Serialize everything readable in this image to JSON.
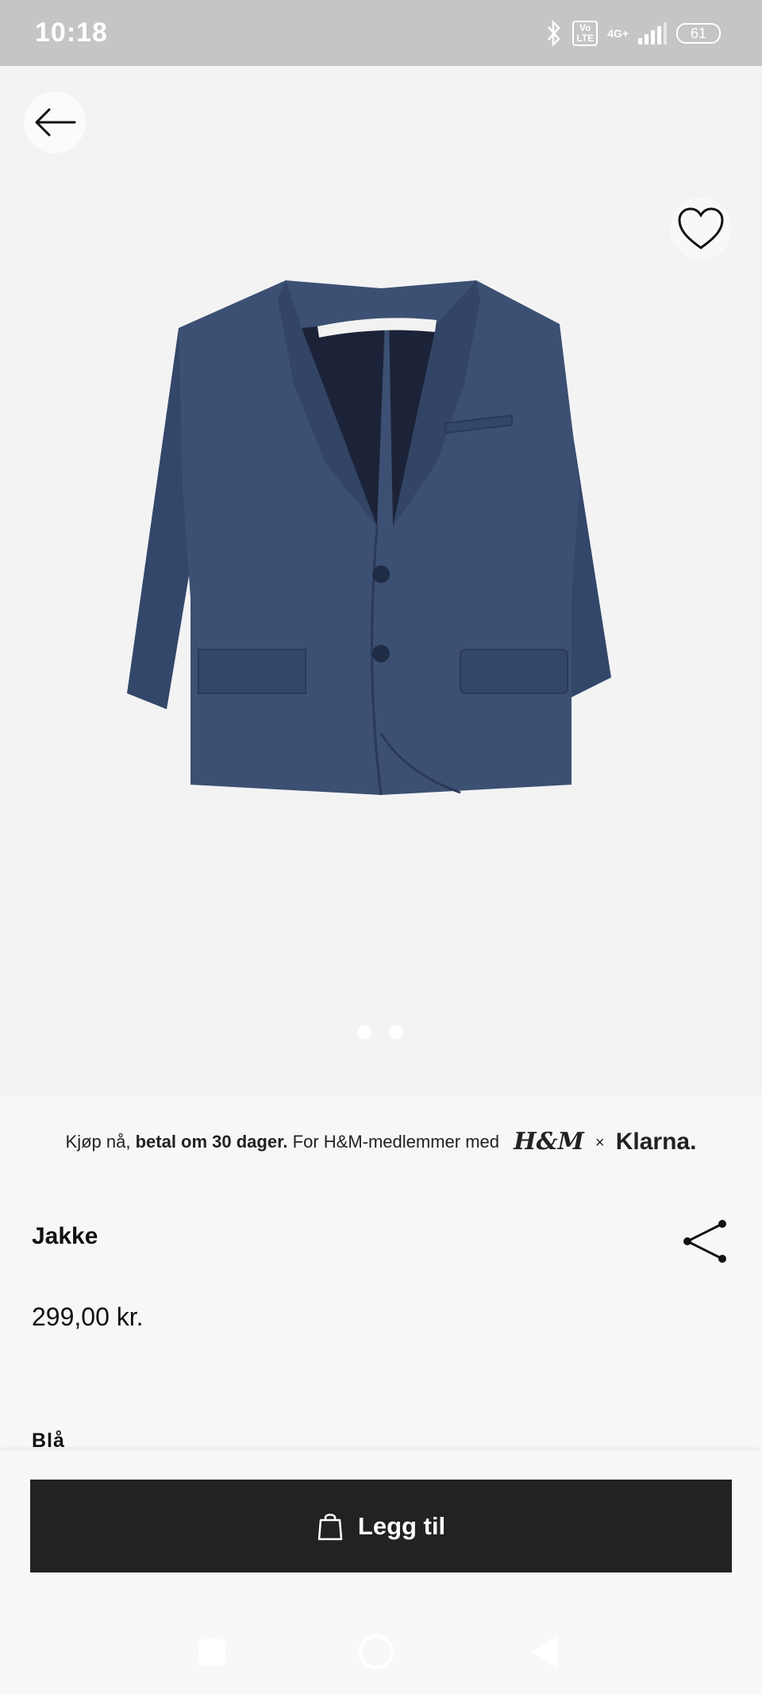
{
  "status": {
    "time": "10:18",
    "network": "4G+",
    "volte": "Vo\nLTE",
    "battery": "61"
  },
  "product": {
    "title": "Jakke",
    "price": "299,00 kr.",
    "color": "Blå",
    "image_alt": "Navy blazer",
    "image_dots": 2
  },
  "klarna": {
    "pre": "Kjøp nå, ",
    "bold": "betal om 30 dager.",
    "post": " For H&M-medlemmer med",
    "hm_logo": "H&M",
    "times": "×",
    "klarna_logo": "Klarna."
  },
  "cta": {
    "label": "Legg til"
  },
  "icons": {
    "back": "arrow-left-icon",
    "favorite": "heart-icon",
    "share": "share-icon",
    "bag": "shopping-bag-icon"
  },
  "colors": {
    "button_bg": "#222222",
    "jacket": "#3c5073"
  }
}
